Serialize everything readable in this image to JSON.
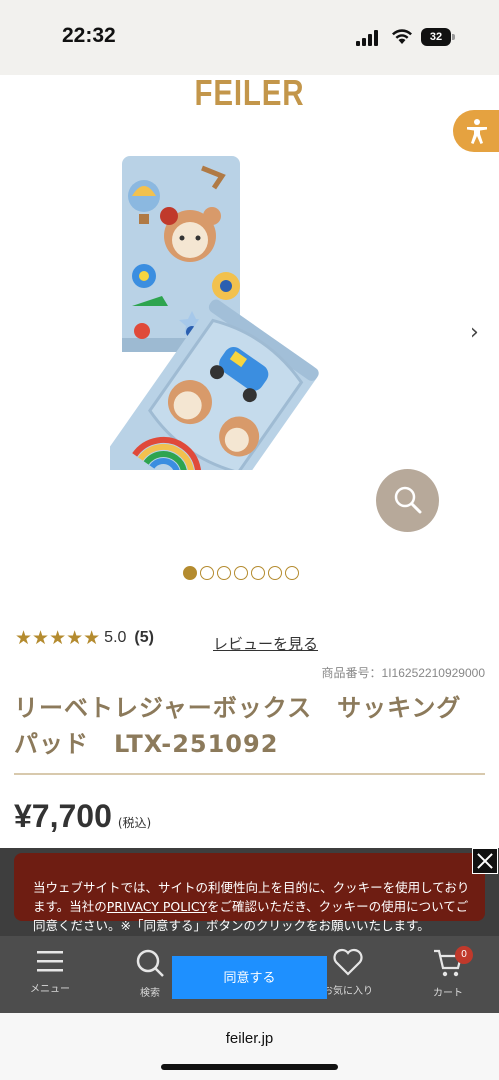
{
  "status_bar": {
    "time": "22:32",
    "battery": "32"
  },
  "header": {
    "logo": "FEILER"
  },
  "gallery": {
    "total_dots": 7,
    "active_index": 0
  },
  "rating": {
    "stars": "★★★★★",
    "score": "5.0",
    "count": "(5)",
    "review_link": "レビューを見る"
  },
  "product": {
    "number": "商品番号：1I16252210929000",
    "title": "リーベトレジャーボックス　サッキングパッド　LTX-251092",
    "price": "¥7,700",
    "tax": "(税込)"
  },
  "cookie": {
    "text_before": "当ウェブサイトでは、サイトの利便性向上を目的に、クッキーを使用しております。当社の",
    "policy_link": "PRIVACY POLICY",
    "text_after": "をご確認いただき、クッキーの使用についてご同意ください。※「同意する」ボタンのクリックをお願いいたします。",
    "agree_button": "同意する"
  },
  "bottom_nav": {
    "menu": "メニュー",
    "search": "検索",
    "favorites": "お気に入り",
    "cart": "カート",
    "cart_count": "0"
  },
  "browser": {
    "url": "feiler.jp"
  },
  "colors": {
    "brand_gold": "#b48b2f",
    "logo_gold": "#c3964a",
    "title_brown": "#8c7a5b",
    "cookie_bg": "#6e1d12",
    "agree_blue": "#1e90ff",
    "a11y_orange": "#e5a240"
  }
}
